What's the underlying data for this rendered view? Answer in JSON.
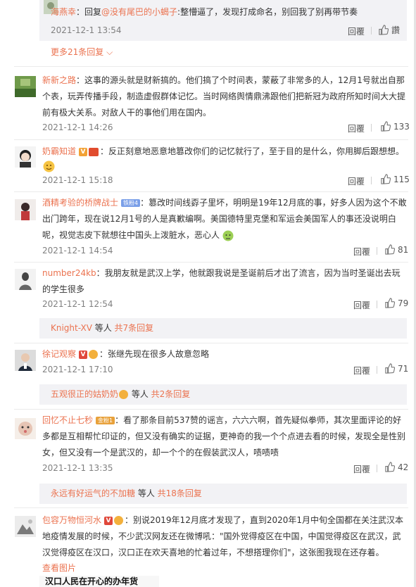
{
  "top_reply": {
    "user": "海燕幸",
    "reply_prefix": "：回复",
    "reply_target": "@没有尾巴的小蝎子",
    "text": ":整懵逼了，发现打成命名，别回我了别再带节奏",
    "time": "2021-12-1 13:54",
    "reply_label": "回覆",
    "like_label": "讚"
  },
  "more_replies": {
    "label": "更多21条回复",
    "chevron": "chevron-down-icon"
  },
  "comments": [
    {
      "user": "新新之路",
      "text": "：这事的源头就是财新搞的。他们搞了个时间表，蒙蔽了非常多的人，12月1号就出自那个表，玩弄传播手段，制造虚假群体记忆。当时网络舆情鼎沸跟他们把新冠为政府所知时间大大提前有极大关系。对敌人干的事他们用在国内。",
      "time": "2021-12-1 14:26",
      "reply_label": "回覆",
      "likes": "133"
    },
    {
      "user": "奶霸知道",
      "text": "：反正刻意地恶意地篡改你们的记忆就行了，至于目的是什么，你用脚后跟想想。",
      "time": "2021-12-1 15:18",
      "reply_label": "回覆",
      "likes": "115"
    },
    {
      "user": "酒精考验的桥牌战士",
      "badge": "铁粉4",
      "text": "：篡改时间线孬子里坏，明明是19年12月底的事，好多人因为这个不敢出门跨年，现在说12月1号的人是真歉编啊。美国德特里克堡和军运会美国军人的事还没说明白呢，视觉志皮下就想往中国头上泼脏水，恶心人",
      "time": "2021-12-1 14:54",
      "reply_label": "回覆",
      "likes": "81"
    },
    {
      "user": "number24kb",
      "text": "：我朋友就是武汉上学，他就跟我说是圣诞前后才出了流言，因为当时圣诞出去玩的学生很多",
      "time": "2021-12-1 12:54",
      "reply_label": "回覆",
      "likes": "79",
      "sub": {
        "user": "Knight-XV",
        "mid": " 等人 ",
        "count": "共7条回复"
      }
    },
    {
      "user": "徐记观察",
      "text": "：张继先现在很多人故意忽略",
      "time": "2021-12-1 17:10",
      "reply_label": "回覆",
      "likes": "71",
      "sub": {
        "user": "五观很正的姑奶奶",
        "mid": " 等人 ",
        "count": "共2条回复"
      }
    },
    {
      "user": "回忆不止七秒",
      "badge": "金粉1",
      "text": "：看了那条目前537赞的谣言，六六六啊，首先疑似拳师，其次里面评论的好多都是互相帮忙印证的，但又没有确实的证据，更神奇的我一个个点进去看的时候，发现全是性别女，但又没有一个是武汉的，却一个个的在假装武汉人，啧啧啧",
      "time": "2021-12-1 13:35",
      "reply_label": "回覆",
      "likes": "42",
      "sub": {
        "user": "永远有好运气的不加糖",
        "mid": " 等人 ",
        "count": "共18条回复"
      }
    },
    {
      "user": "包容万物恒河水",
      "text": "：别说2019年12月底才发现了，直到2020年1月中旬全国都在关注武汉本地疫情发展的时候，不少武汉网友还在微博吼：\"国外觉得疫区在中国，中国觉得疫区在武汉，武汉觉得疫区在汉口，汉口正在欢天喜地的忙着过年，不想搭理你们\"，这张图我现在还存着。",
      "view_image": "查看图片",
      "image_caption": "汉口人民在开心的办年货"
    }
  ]
}
